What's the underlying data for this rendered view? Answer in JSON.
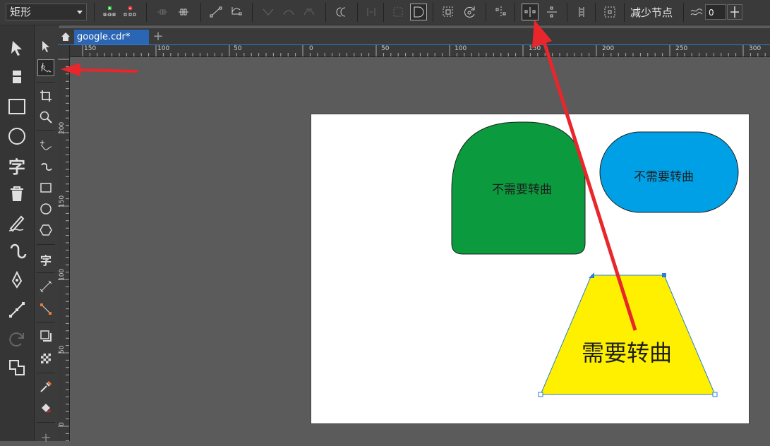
{
  "propbar": {
    "shape_type": "矩形",
    "reduce_nodes_label": "减少节点",
    "smoothness_value": "0"
  },
  "tabs": {
    "document_name": "google.cdr*"
  },
  "rulers": {
    "horizontal": [
      "150",
      "100",
      "50",
      "0",
      "50",
      "100",
      "150",
      "200",
      "250",
      "300"
    ],
    "vertical": [
      "200",
      "150",
      "100",
      "50",
      "0"
    ]
  },
  "canvas": {
    "green_shape_label": "不需要转曲",
    "blue_shape_label": "不需要转曲",
    "yellow_shape_label": "需要转曲"
  },
  "colors": {
    "green_fill": "#0b9a3e",
    "blue_fill": "#00a0e6",
    "yellow_fill": "#fff000",
    "annotation_arrow": "#e8262b",
    "active_tab": "#2b66b5"
  }
}
